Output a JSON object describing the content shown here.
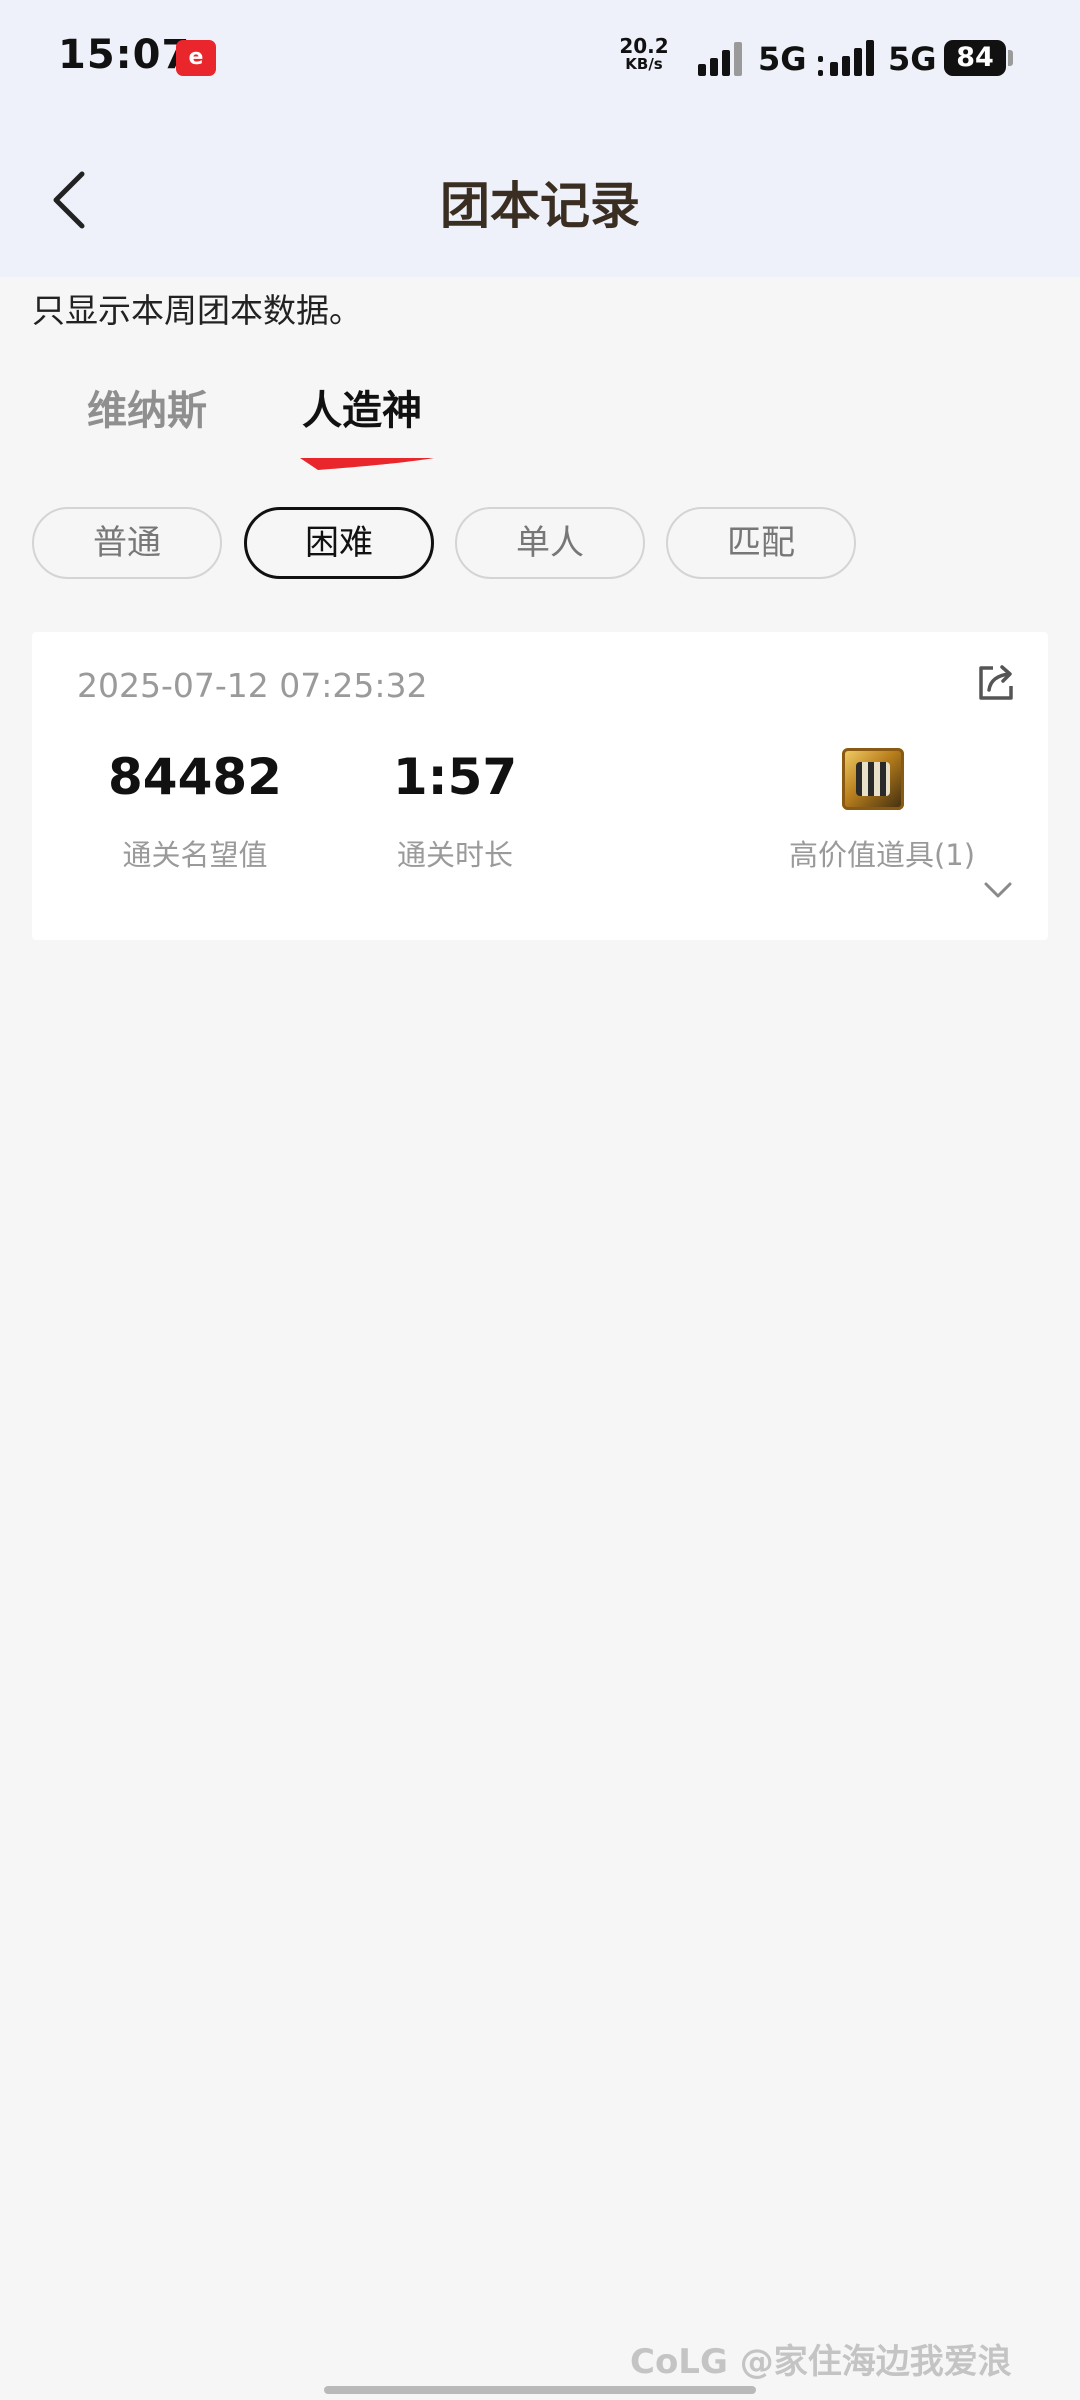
{
  "status_bar": {
    "time": "15:07",
    "app_badge": "e",
    "net_speed_value": "20.2",
    "net_speed_unit": "KB/s",
    "network_1": "5G",
    "network_2": "5G",
    "battery": "84"
  },
  "header": {
    "title": "团本记录"
  },
  "notice": "只显示本周团本数据。",
  "tabs": [
    {
      "label": "维纳斯",
      "active": false
    },
    {
      "label": "人造神",
      "active": true
    }
  ],
  "filters": [
    {
      "label": "普通",
      "active": false
    },
    {
      "label": "困难",
      "active": true
    },
    {
      "label": "单人",
      "active": false
    },
    {
      "label": "匹配",
      "active": false
    }
  ],
  "record": {
    "timestamp": "2025-07-12 07:25:32",
    "reputation_value": "84482",
    "reputation_label": "通关名望值",
    "duration_value": "1:57",
    "duration_label": "通关时长",
    "items_label": "高价值道具(1)"
  },
  "watermark": "CoLG @家住海边我爱浪",
  "colors": {
    "header_bg": "#eef1f9",
    "page_bg": "#f6f6f6",
    "tab_underline": "#e8262b",
    "title": "#3a2e22"
  },
  "icons": {
    "back": "chevron-left-icon",
    "share": "share-icon",
    "expand": "chevron-down-icon",
    "item": "treasure-item-icon"
  }
}
